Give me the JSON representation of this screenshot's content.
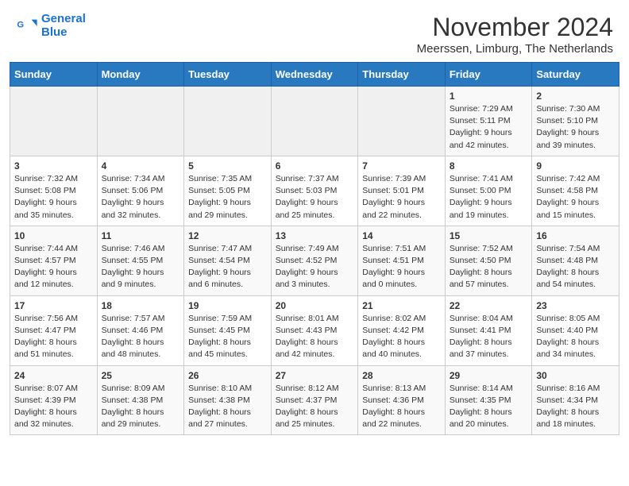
{
  "app": {
    "logo_line1": "General",
    "logo_line2": "Blue"
  },
  "header": {
    "month_title": "November 2024",
    "location": "Meerssen, Limburg, The Netherlands"
  },
  "weekdays": [
    "Sunday",
    "Monday",
    "Tuesday",
    "Wednesday",
    "Thursday",
    "Friday",
    "Saturday"
  ],
  "weeks": [
    [
      {
        "day": "",
        "info": ""
      },
      {
        "day": "",
        "info": ""
      },
      {
        "day": "",
        "info": ""
      },
      {
        "day": "",
        "info": ""
      },
      {
        "day": "",
        "info": ""
      },
      {
        "day": "1",
        "info": "Sunrise: 7:29 AM\nSunset: 5:11 PM\nDaylight: 9 hours and 42 minutes."
      },
      {
        "day": "2",
        "info": "Sunrise: 7:30 AM\nSunset: 5:10 PM\nDaylight: 9 hours and 39 minutes."
      }
    ],
    [
      {
        "day": "3",
        "info": "Sunrise: 7:32 AM\nSunset: 5:08 PM\nDaylight: 9 hours and 35 minutes."
      },
      {
        "day": "4",
        "info": "Sunrise: 7:34 AM\nSunset: 5:06 PM\nDaylight: 9 hours and 32 minutes."
      },
      {
        "day": "5",
        "info": "Sunrise: 7:35 AM\nSunset: 5:05 PM\nDaylight: 9 hours and 29 minutes."
      },
      {
        "day": "6",
        "info": "Sunrise: 7:37 AM\nSunset: 5:03 PM\nDaylight: 9 hours and 25 minutes."
      },
      {
        "day": "7",
        "info": "Sunrise: 7:39 AM\nSunset: 5:01 PM\nDaylight: 9 hours and 22 minutes."
      },
      {
        "day": "8",
        "info": "Sunrise: 7:41 AM\nSunset: 5:00 PM\nDaylight: 9 hours and 19 minutes."
      },
      {
        "day": "9",
        "info": "Sunrise: 7:42 AM\nSunset: 4:58 PM\nDaylight: 9 hours and 15 minutes."
      }
    ],
    [
      {
        "day": "10",
        "info": "Sunrise: 7:44 AM\nSunset: 4:57 PM\nDaylight: 9 hours and 12 minutes."
      },
      {
        "day": "11",
        "info": "Sunrise: 7:46 AM\nSunset: 4:55 PM\nDaylight: 9 hours and 9 minutes."
      },
      {
        "day": "12",
        "info": "Sunrise: 7:47 AM\nSunset: 4:54 PM\nDaylight: 9 hours and 6 minutes."
      },
      {
        "day": "13",
        "info": "Sunrise: 7:49 AM\nSunset: 4:52 PM\nDaylight: 9 hours and 3 minutes."
      },
      {
        "day": "14",
        "info": "Sunrise: 7:51 AM\nSunset: 4:51 PM\nDaylight: 9 hours and 0 minutes."
      },
      {
        "day": "15",
        "info": "Sunrise: 7:52 AM\nSunset: 4:50 PM\nDaylight: 8 hours and 57 minutes."
      },
      {
        "day": "16",
        "info": "Sunrise: 7:54 AM\nSunset: 4:48 PM\nDaylight: 8 hours and 54 minutes."
      }
    ],
    [
      {
        "day": "17",
        "info": "Sunrise: 7:56 AM\nSunset: 4:47 PM\nDaylight: 8 hours and 51 minutes."
      },
      {
        "day": "18",
        "info": "Sunrise: 7:57 AM\nSunset: 4:46 PM\nDaylight: 8 hours and 48 minutes."
      },
      {
        "day": "19",
        "info": "Sunrise: 7:59 AM\nSunset: 4:45 PM\nDaylight: 8 hours and 45 minutes."
      },
      {
        "day": "20",
        "info": "Sunrise: 8:01 AM\nSunset: 4:43 PM\nDaylight: 8 hours and 42 minutes."
      },
      {
        "day": "21",
        "info": "Sunrise: 8:02 AM\nSunset: 4:42 PM\nDaylight: 8 hours and 40 minutes."
      },
      {
        "day": "22",
        "info": "Sunrise: 8:04 AM\nSunset: 4:41 PM\nDaylight: 8 hours and 37 minutes."
      },
      {
        "day": "23",
        "info": "Sunrise: 8:05 AM\nSunset: 4:40 PM\nDaylight: 8 hours and 34 minutes."
      }
    ],
    [
      {
        "day": "24",
        "info": "Sunrise: 8:07 AM\nSunset: 4:39 PM\nDaylight: 8 hours and 32 minutes."
      },
      {
        "day": "25",
        "info": "Sunrise: 8:09 AM\nSunset: 4:38 PM\nDaylight: 8 hours and 29 minutes."
      },
      {
        "day": "26",
        "info": "Sunrise: 8:10 AM\nSunset: 4:38 PM\nDaylight: 8 hours and 27 minutes."
      },
      {
        "day": "27",
        "info": "Sunrise: 8:12 AM\nSunset: 4:37 PM\nDaylight: 8 hours and 25 minutes."
      },
      {
        "day": "28",
        "info": "Sunrise: 8:13 AM\nSunset: 4:36 PM\nDaylight: 8 hours and 22 minutes."
      },
      {
        "day": "29",
        "info": "Sunrise: 8:14 AM\nSunset: 4:35 PM\nDaylight: 8 hours and 20 minutes."
      },
      {
        "day": "30",
        "info": "Sunrise: 8:16 AM\nSunset: 4:34 PM\nDaylight: 8 hours and 18 minutes."
      }
    ]
  ]
}
